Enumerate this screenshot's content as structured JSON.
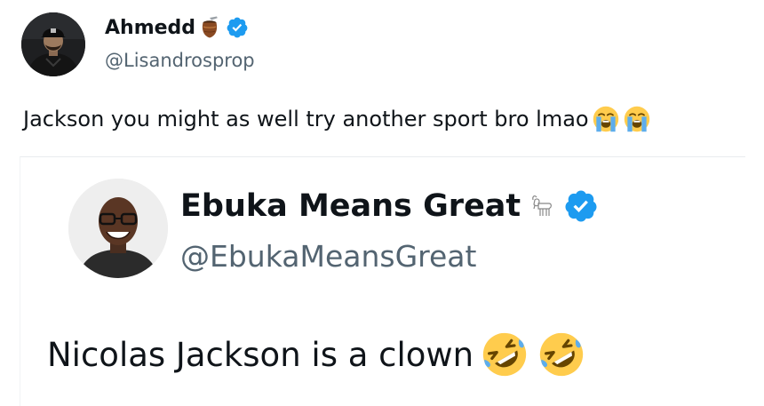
{
  "tweet": {
    "author_name": "Ahmedd",
    "author_handle": "@Lisandrosprop",
    "text": "Jackson you might as well try another sport bro lmao",
    "name_icons": [
      "mate-gourd-icon",
      "verified-badge-icon"
    ],
    "text_emoji": [
      "loudly-crying-face-emoji",
      "loudly-crying-face-emoji"
    ]
  },
  "quoted_tweet": {
    "author_name": "Ebuka Means Great",
    "author_handle": "@EbukaMeansGreat",
    "text": "Nicolas Jackson is a clown",
    "name_icons": [
      "goat-icon",
      "verified-badge-icon"
    ],
    "text_emoji": [
      "rolling-on-floor-laughing-emoji",
      "rolling-on-floor-laughing-emoji"
    ]
  },
  "colors": {
    "text_primary": "#0f1419",
    "text_secondary": "#536471",
    "verified_blue": "#1d9bf0",
    "background": "#ffffff"
  }
}
